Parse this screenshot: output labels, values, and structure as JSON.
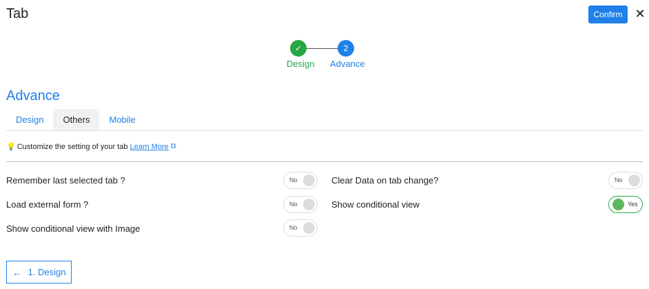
{
  "header": {
    "title": "Tab",
    "confirm_label": "Confirm",
    "close_glyph": "✕"
  },
  "stepper": {
    "steps": [
      {
        "label": "Design",
        "status": "complete",
        "icon": "check-icon",
        "glyph": "✓"
      },
      {
        "label": "Advance",
        "status": "current",
        "number": "2"
      }
    ]
  },
  "section": {
    "title": "Advance"
  },
  "tabs": [
    {
      "label": "Design",
      "active": false
    },
    {
      "label": "Others",
      "active": true
    },
    {
      "label": "Mobile",
      "active": false
    }
  ],
  "hint": {
    "bulb_glyph": "💡",
    "text": "Customize the setting of your tab",
    "link_text": "Learn More",
    "ext_glyph": "⧉"
  },
  "settings": {
    "remember_last_tab": {
      "label": "Remember last selected tab ?",
      "value": "No"
    },
    "load_external_form": {
      "label": "Load external form ?",
      "value": "No"
    },
    "show_conditional_view_image": {
      "label": "Show conditional view with Image",
      "value": "No"
    },
    "clear_data_on_tab_change": {
      "label": "Clear Data on tab change?",
      "value": "No"
    },
    "show_conditional_view": {
      "label": "Show conditional view",
      "value": "Yes"
    }
  },
  "footer": {
    "back_arrow": "←",
    "back_label": "1. Design"
  },
  "colors": {
    "primary": "#1f80e8",
    "success": "#28a745",
    "toggle_on_knob": "#5cb85c"
  }
}
